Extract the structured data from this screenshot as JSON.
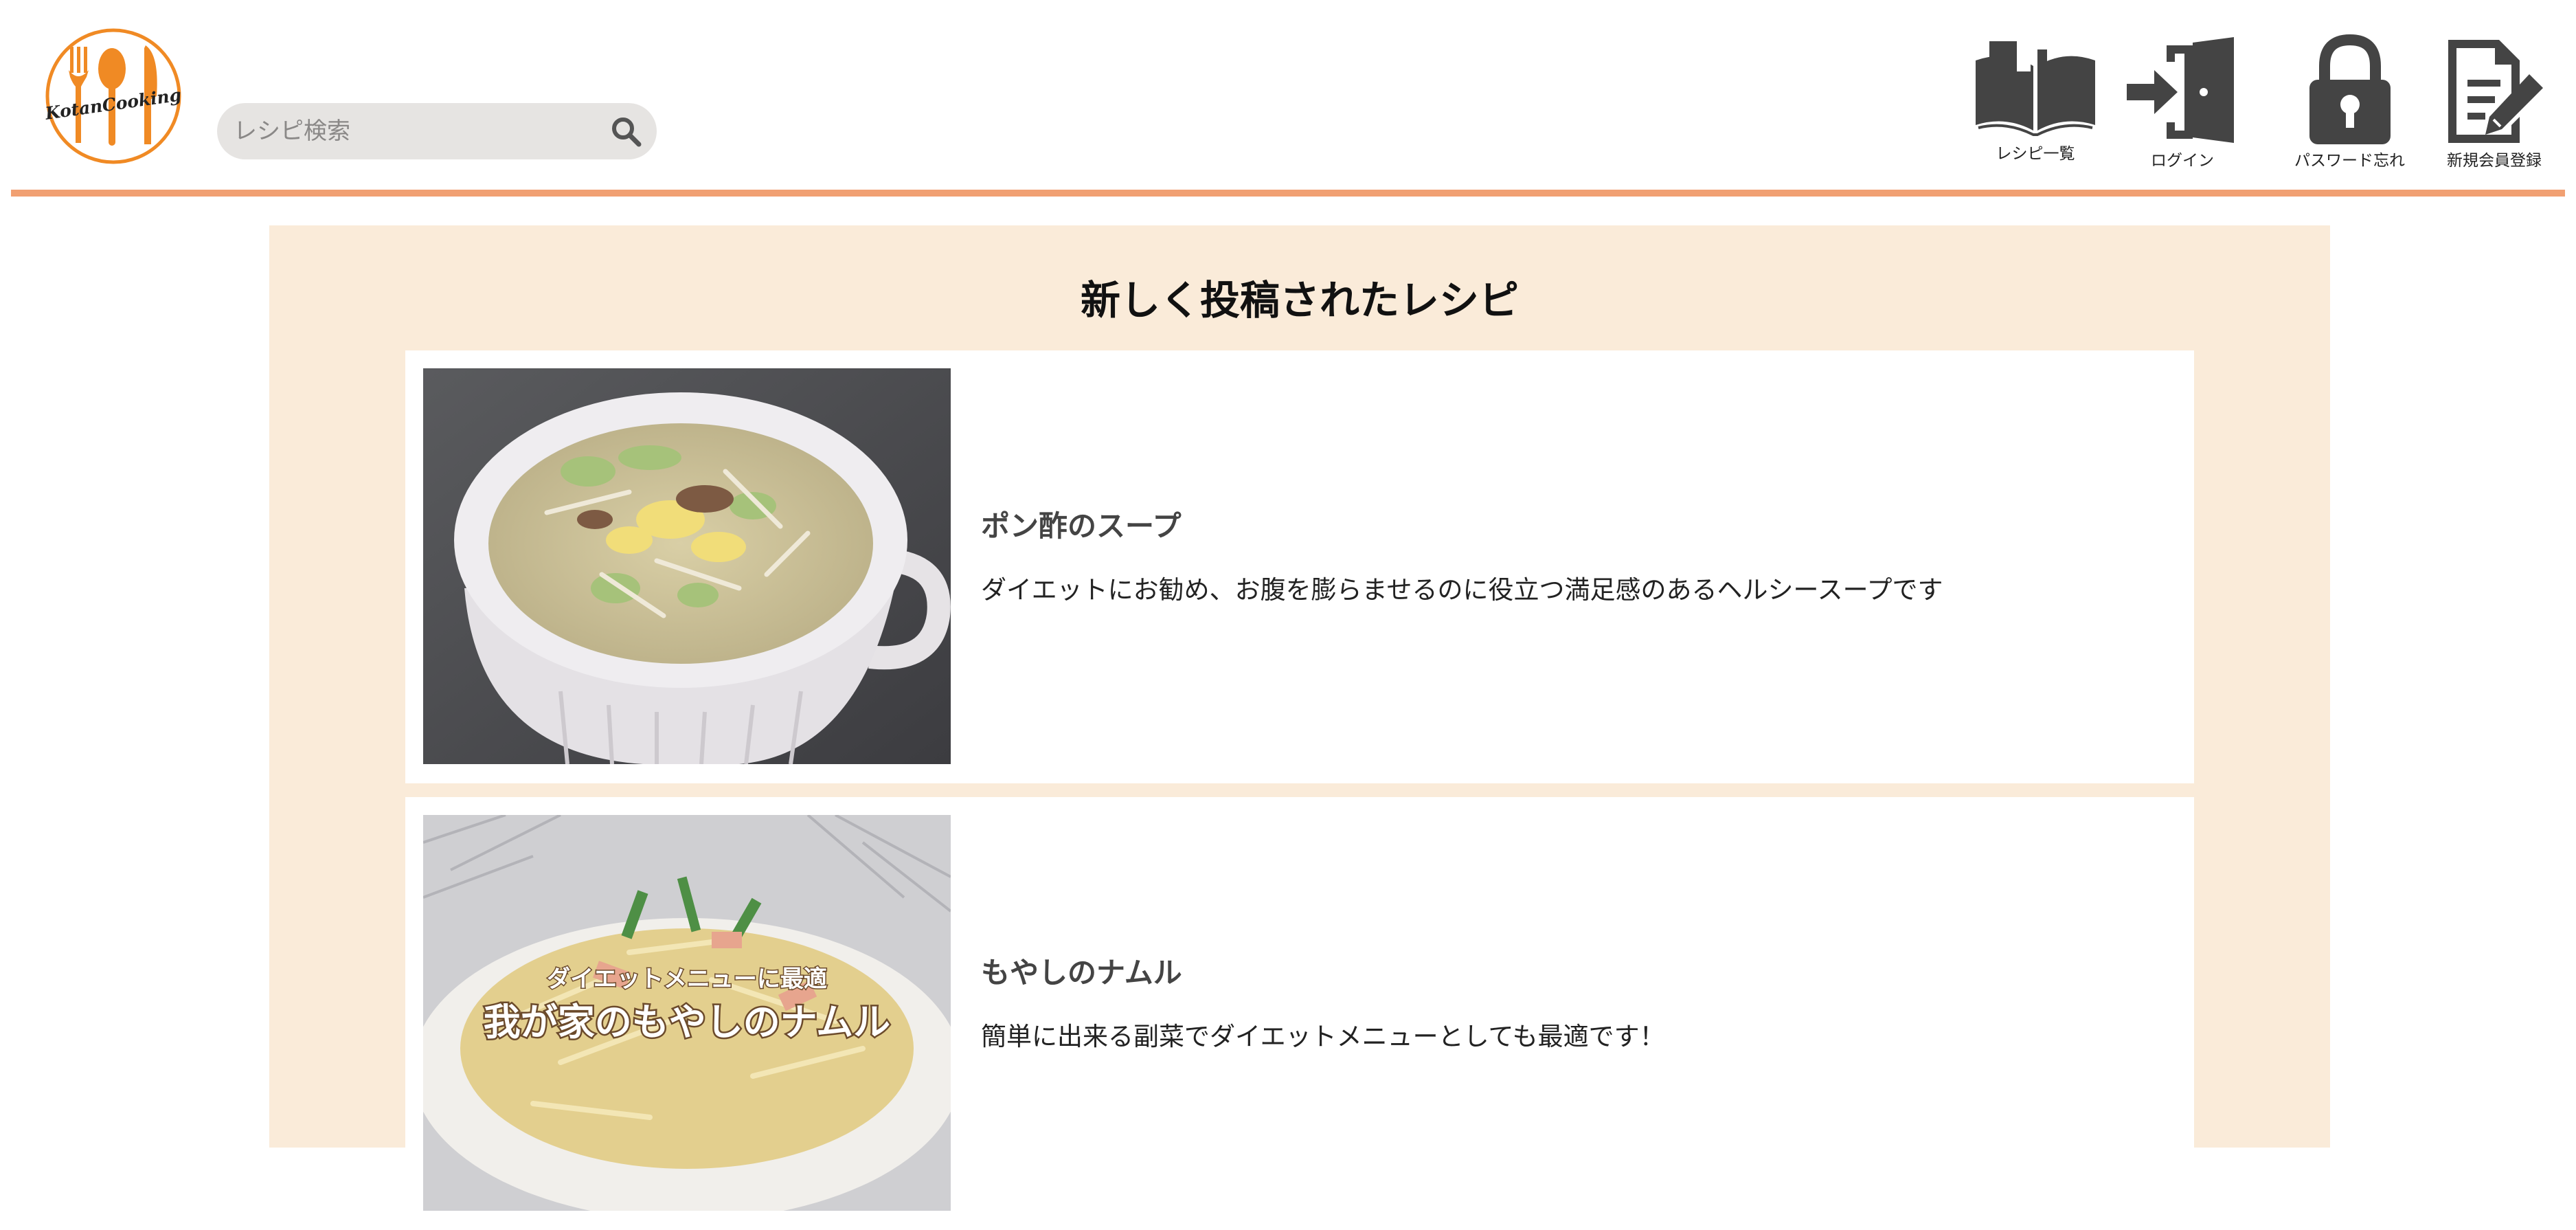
{
  "brand": {
    "logo_text": "KotanCooking",
    "accent_color": "#f08a24"
  },
  "search": {
    "placeholder": "レシピ検索",
    "icon": "search-icon"
  },
  "nav": [
    {
      "label": "レシピ一覧",
      "icon": "open-book-icon"
    },
    {
      "label": "ログイン",
      "icon": "login-door-icon"
    },
    {
      "label": "パスワード忘れ",
      "icon": "padlock-icon"
    },
    {
      "label": "新規会員登録",
      "icon": "signup-document-pen-icon"
    }
  ],
  "colors": {
    "divider": "#f1a072",
    "panel_bg": "#faebd9",
    "icon": "#444444"
  },
  "main": {
    "title": "新しく投稿されたレシピ",
    "recipes": [
      {
        "title": "ポン酢のスープ",
        "description": "ダイエットにお勧め、お腹を膨らませるのに役立つ満足感のあるヘルシースープです",
        "image": "soup-bowl-photo"
      },
      {
        "title": "もやしのナムル",
        "description": "簡単に出来る副菜でダイエットメニューとしても最適です！",
        "image": "bean-sprout-namul-photo",
        "image_caption_small": "ダイエットメニューに最適",
        "image_caption_large": "我が家のもやしのナムル"
      }
    ]
  }
}
